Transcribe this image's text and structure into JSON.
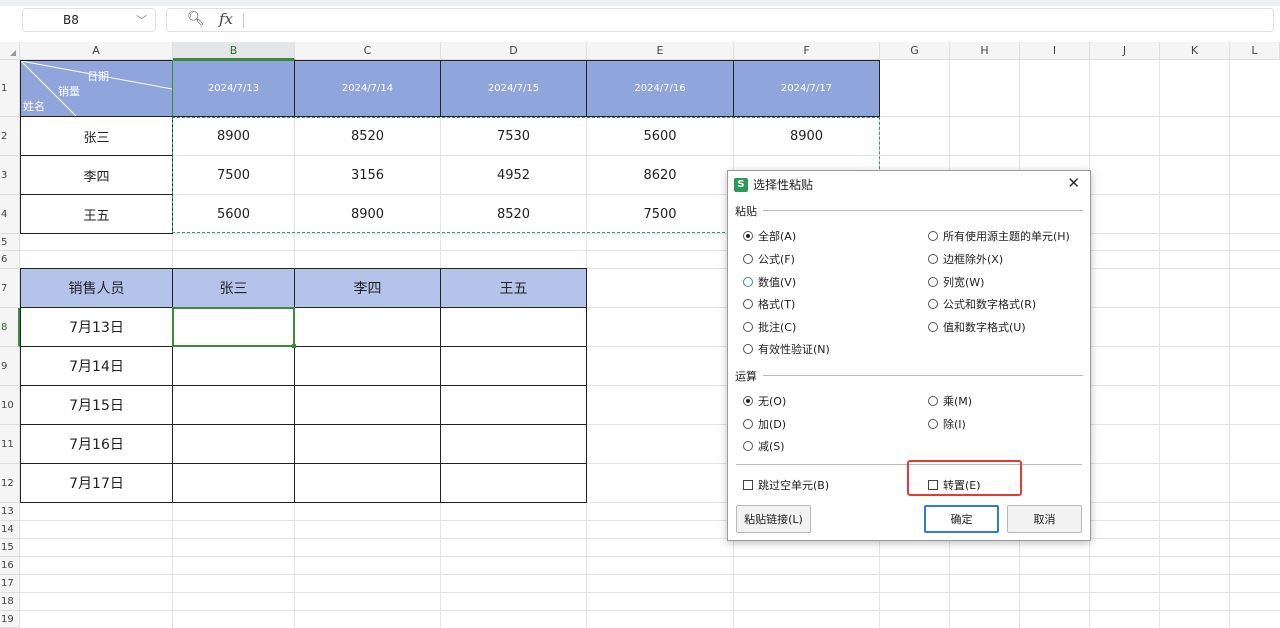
{
  "formula_bar": {
    "name_box": "B8",
    "fx_label": "fx",
    "zoom_icon": "zoom-icon"
  },
  "columns": [
    "A",
    "B",
    "C",
    "D",
    "E",
    "F",
    "G",
    "H",
    "I",
    "J",
    "K",
    "L"
  ],
  "rows": [
    "1",
    "2",
    "3",
    "4",
    "5",
    "6",
    "7",
    "8",
    "9",
    "10",
    "11",
    "12",
    "13",
    "14",
    "15",
    "16",
    "17",
    "18",
    "19"
  ],
  "table1": {
    "diag_header": {
      "top": "日期",
      "middle": "销量",
      "bottom": "姓名"
    },
    "dates": [
      "2024/7/13",
      "2024/7/14",
      "2024/7/15",
      "2024/7/16",
      "2024/7/17"
    ],
    "rows": [
      {
        "name": "张三",
        "values": [
          "8900",
          "8520",
          "7530",
          "5600",
          "8900"
        ]
      },
      {
        "name": "李四",
        "values": [
          "7500",
          "3156",
          "4952",
          "8620",
          ""
        ]
      },
      {
        "name": "王五",
        "values": [
          "5600",
          "8900",
          "8520",
          "7500",
          ""
        ]
      }
    ]
  },
  "table2": {
    "header": [
      "销售人员",
      "张三",
      "李四",
      "王五"
    ],
    "dates": [
      "7月13日",
      "7月14日",
      "7月15日",
      "7月16日",
      "7月17日"
    ]
  },
  "dialog": {
    "title": "选择性粘贴",
    "paste_section": "粘贴",
    "paste_options_left": [
      "全部(A)",
      "公式(F)",
      "数值(V)",
      "格式(T)",
      "批注(C)",
      "有效性验证(N)"
    ],
    "paste_options_right": [
      "所有使用源主题的单元(H)",
      "边框除外(X)",
      "列宽(W)",
      "公式和数字格式(R)",
      "值和数字格式(U)"
    ],
    "operation_section": "运算",
    "operation_left": [
      "无(O)",
      "加(D)",
      "减(S)"
    ],
    "operation_right": [
      "乘(M)",
      "除(I)"
    ],
    "skip_blanks": "跳过空单元(B)",
    "transpose": "转置(E)",
    "paste_link": "粘贴链接(L)",
    "ok": "确定",
    "cancel": "取消"
  }
}
